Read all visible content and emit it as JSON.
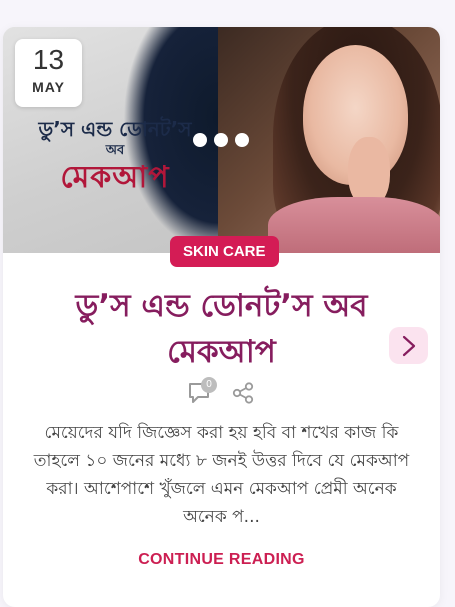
{
  "post": {
    "date_day": "13",
    "date_month": "MAY",
    "image_title_line1": "ডু’স এন্ড ডোনট’স",
    "image_title_line2": "অব",
    "image_title_line3": "মেকআপ",
    "category": "SKIN CARE",
    "title": "ডু’স এন্ড ডোনট’স অব মেকআপ",
    "comment_count": "0",
    "excerpt": "মেয়েদের যদি জিজ্ঞেস করা হয় হবি বা শখের কাজ কি তাহলে ১০ জনের মধ্যে ৮ জনই উত্তর দিবে যে মেকআপ করা। আশেপাশে খুঁজলে এমন মেকআপ প্রেমী অনেক অনেক প...",
    "read_more": "CONTINUE READING"
  },
  "icons": {
    "arrow": "chevron-right-icon",
    "comment": "comment-icon",
    "share": "share-icon"
  },
  "colors": {
    "accent": "#d41c55",
    "title": "#861d5e",
    "read_more": "#cc1f52",
    "arrow_bg": "#fbe3ef"
  }
}
